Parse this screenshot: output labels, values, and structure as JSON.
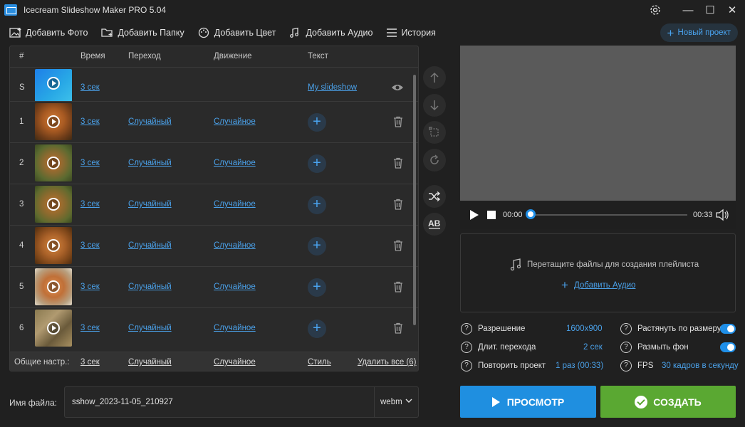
{
  "window": {
    "title": "Icecream Slideshow Maker PRO 5.04",
    "settings_icon": "gear-icon",
    "minimize": "—",
    "maximize": "☐",
    "close": "✕"
  },
  "toolbar": {
    "add_photo": "Добавить Фото",
    "add_folder": "Добавить Папку",
    "add_color": "Добавить Цвет",
    "add_audio": "Добавить Аудио",
    "history": "История",
    "new_project": "Новый проект"
  },
  "table": {
    "headers": {
      "num": "#",
      "time": "Время",
      "transition": "Переход",
      "motion": "Движение",
      "text": "Текст"
    },
    "rows": [
      {
        "num": "S",
        "time": "3 сек",
        "transition": "",
        "motion": "",
        "text": "My slideshow",
        "type": "title"
      },
      {
        "num": "1",
        "time": "3 сек",
        "transition": "Случайный",
        "motion": "Случайное",
        "type": "photo"
      },
      {
        "num": "2",
        "time": "3 сек",
        "transition": "Случайный",
        "motion": "Случайное",
        "type": "photo"
      },
      {
        "num": "3",
        "time": "3 сек",
        "transition": "Случайный",
        "motion": "Случайное",
        "type": "photo"
      },
      {
        "num": "4",
        "time": "3 сек",
        "transition": "Случайный",
        "motion": "Случайное",
        "type": "photo"
      },
      {
        "num": "5",
        "time": "3 сек",
        "transition": "Случайный",
        "motion": "Случайное",
        "type": "photo"
      },
      {
        "num": "6",
        "time": "3 сек",
        "transition": "Случайный",
        "motion": "Случайное",
        "type": "photo"
      }
    ],
    "footer": {
      "label": "Общие настр.:",
      "time": "3 сек",
      "transition": "Случайный",
      "motion": "Случайное",
      "style": "Стиль",
      "delete_all": "Удалить все (6)"
    }
  },
  "player": {
    "current_time": "00:00",
    "total_time": "00:33",
    "progress": 0
  },
  "dropzone": {
    "hint": "Перетащите файлы для создания плейлиста",
    "add_audio": "Добавить Аудио"
  },
  "settings": {
    "resolution": {
      "label": "Разрешение",
      "value": "1600x900"
    },
    "transition_duration": {
      "label": "Длит. перехода",
      "value": "2 сек"
    },
    "repeat": {
      "label": "Повторить проект",
      "value": "1 раз (00:33)"
    },
    "stretch": {
      "label": "Растянуть по размеру",
      "on": true
    },
    "blur_bg": {
      "label": "Размыть фон",
      "on": true
    },
    "fps": {
      "label": "FPS",
      "value": "30 кадров в секунду"
    }
  },
  "file": {
    "label": "Имя файла:",
    "name": "sshow_2023-11-05_210927",
    "format": "webm"
  },
  "actions": {
    "preview": "ПРОСМОТР",
    "create": "СОЗДАТЬ"
  },
  "colors": {
    "accent": "#1f8fe0",
    "create": "#5aa832",
    "link": "#4aa0e8",
    "bg": "#202020"
  }
}
